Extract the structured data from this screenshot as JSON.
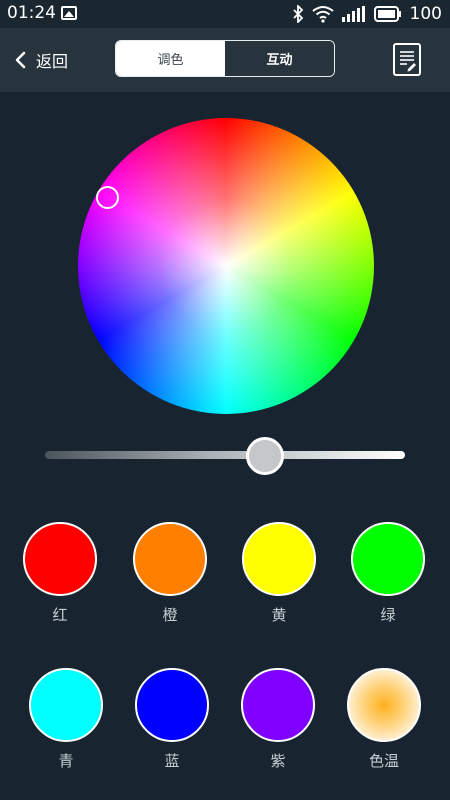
{
  "status_bar": {
    "time": "01:24",
    "battery": "100"
  },
  "header": {
    "back_label": "返回",
    "tabs": [
      {
        "label": "调色",
        "active": true
      },
      {
        "label": "互动",
        "active": false
      }
    ]
  },
  "color_wheel": {
    "selected_hue_color": "#ff33cc"
  },
  "brightness_slider": {
    "value": 0.61
  },
  "presets": [
    {
      "label": "红",
      "color": "#ff0000"
    },
    {
      "label": "橙",
      "color": "#ff8000"
    },
    {
      "label": "黄",
      "color": "#ffff00"
    },
    {
      "label": "绿",
      "color": "#00ff00"
    },
    {
      "label": "青",
      "color": "#00ffff"
    },
    {
      "label": "蓝",
      "color": "#0000ff"
    },
    {
      "label": "紫",
      "color": "#8000ff"
    },
    {
      "label": "色温",
      "color": "#ffb020"
    }
  ],
  "colors": {
    "background": "#18242f",
    "header": "#27343d",
    "label_text": "#c7ced3"
  }
}
